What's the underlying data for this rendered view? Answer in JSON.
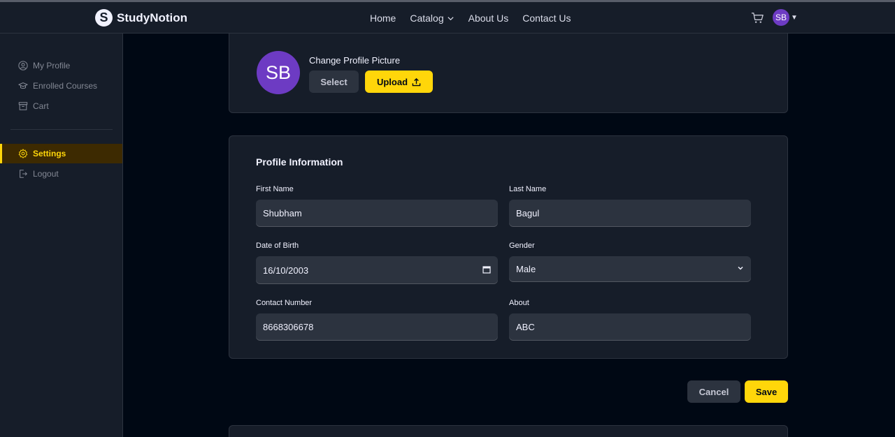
{
  "brand": {
    "logo_letter": "S",
    "name": "StudyNotion"
  },
  "nav": {
    "home": "Home",
    "catalog": "Catalog",
    "about": "About Us",
    "contact": "Contact Us"
  },
  "user": {
    "initials": "SB"
  },
  "sidebar": {
    "items": [
      {
        "label": "My Profile",
        "icon": "user-circle-icon"
      },
      {
        "label": "Enrolled Courses",
        "icon": "graduation-cap-icon"
      },
      {
        "label": "Cart",
        "icon": "archive-icon"
      },
      {
        "label": "Settings",
        "icon": "gear-icon",
        "active": true
      },
      {
        "label": "Logout",
        "icon": "logout-icon"
      }
    ]
  },
  "profile_picture": {
    "initials": "SB",
    "title": "Change Profile Picture",
    "select_label": "Select",
    "upload_label": "Upload"
  },
  "profile_info": {
    "title": "Profile Information",
    "first_name_label": "First Name",
    "first_name_value": "Shubham",
    "last_name_label": "Last Name",
    "last_name_value": "Bagul",
    "dob_label": "Date of Birth",
    "dob_value": "16/10/2003",
    "gender_label": "Gender",
    "gender_value": "Male",
    "contact_label": "Contact Number",
    "contact_value": "8668306678",
    "about_label": "About",
    "about_value": "ABC"
  },
  "actions": {
    "cancel": "Cancel",
    "save": "Save"
  },
  "colors": {
    "accent": "#ffd60a",
    "avatar": "#6d3bc3",
    "panel": "#161d29",
    "background": "#000814"
  }
}
